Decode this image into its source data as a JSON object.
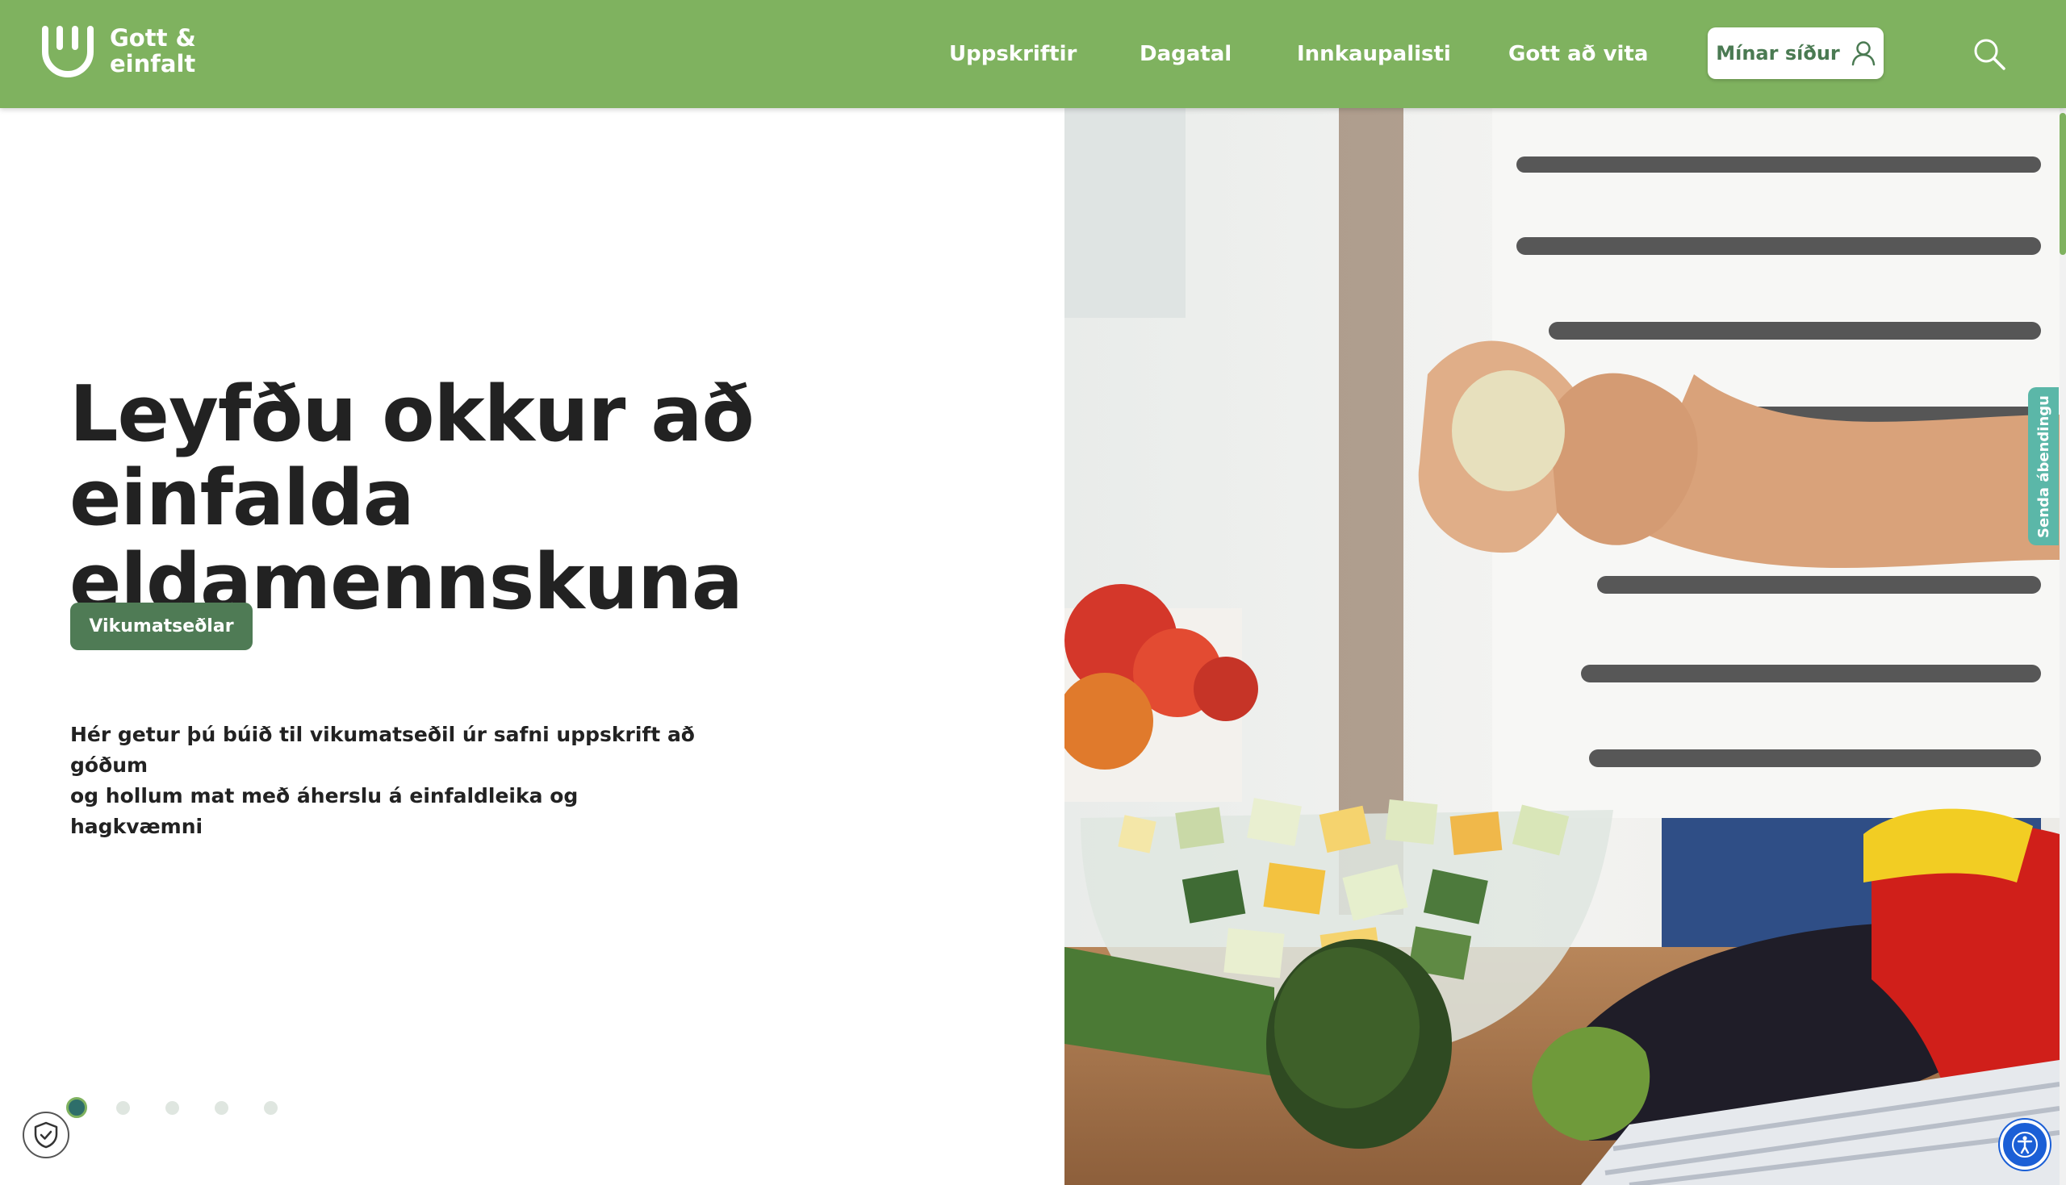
{
  "brand": {
    "line1": "Gott &",
    "line2": "einfalt",
    "color": "#7fb25f"
  },
  "nav": {
    "items": [
      {
        "label": "Uppskriftir"
      },
      {
        "label": "Dagatal"
      },
      {
        "label": "Innkaupalisti"
      },
      {
        "label": "Gott að vita"
      }
    ],
    "account_label": "Mínar síður"
  },
  "hero": {
    "title_line1": "Leyfðu okkur að einfalda",
    "title_line2": "eldamennskuna",
    "cta_label": "Vikumatseðlar",
    "intro_line1": "Hér getur þú búið til vikumatseðil úr safni uppskrift að góðum",
    "intro_line2": "og hollum mat með áherslu á einfaldleika og hagkvæmni"
  },
  "carousel": {
    "slides": 5,
    "active": 1
  },
  "feedback": {
    "label": "Senda ábendingu"
  },
  "colors": {
    "header": "#7fb25f",
    "cta": "#4f7b55",
    "feedback": "#5bb7a8",
    "accessibility": "#1b5fd6"
  }
}
